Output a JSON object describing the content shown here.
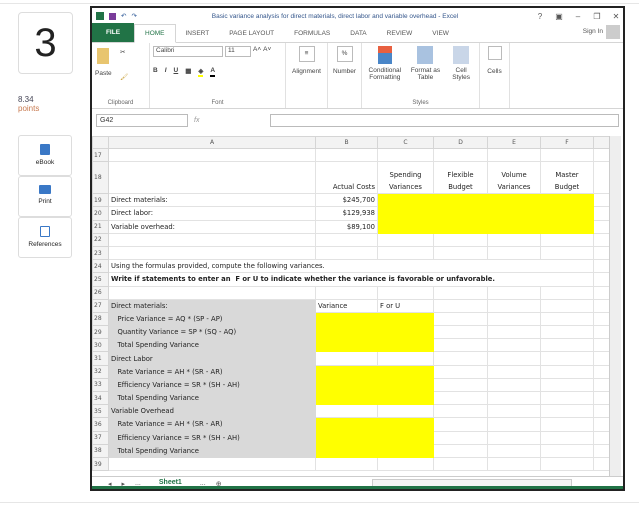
{
  "question": {
    "number": "3",
    "points_value": "8.34",
    "points_label": "points"
  },
  "tools": [
    {
      "label": "eBook"
    },
    {
      "label": "Print"
    },
    {
      "label": "References"
    }
  ],
  "excel": {
    "title": "Basic variance analysis for direct materials, direct labor and variable overhead - Excel",
    "window_buttons": [
      "?",
      "▣",
      "–",
      "❐",
      "✕"
    ],
    "tabs": [
      "FILE",
      "HOME",
      "INSERT",
      "PAGE LAYOUT",
      "FORMULAS",
      "DATA",
      "REVIEW",
      "VIEW"
    ],
    "sign_in": "Sign In",
    "ribbon": {
      "paste": "Paste",
      "clipboard": "Clipboard",
      "font_name": "Calibri",
      "font_size": "11",
      "font": "Font",
      "alignment": "Alignment",
      "number": "Number",
      "conditional_formatting": "Conditional Formatting",
      "format_as_table": "Format as Table",
      "cell_styles": "Cell Styles",
      "styles": "Styles",
      "cells": "Cells"
    },
    "name_box": "G42",
    "fx": "fx",
    "columns": [
      "A",
      "B",
      "C",
      "D",
      "E",
      "F"
    ],
    "rows": [
      {
        "n": "17",
        "a": "",
        "b": ""
      },
      {
        "n": "18",
        "a": "",
        "b": "Actual Costs",
        "c": "Spending Variances",
        "d": "Flexible Budget",
        "e": "Volume Variances",
        "f": "Master Budget"
      },
      {
        "n": "19",
        "a": "Direct materials:",
        "b": "$245,700"
      },
      {
        "n": "20",
        "a": "Direct labor:",
        "b": "$129,938"
      },
      {
        "n": "21",
        "a": "Variable overhead:",
        "b": "$89,100"
      },
      {
        "n": "22",
        "a": ""
      },
      {
        "n": "23",
        "a": ""
      },
      {
        "n": "24",
        "a": "Using the formulas provided, compute the following variances."
      },
      {
        "n": "25",
        "a": "Write if statements to enter an  F or U to indicate whether the variance is favorable or unfavorable."
      },
      {
        "n": "26",
        "a": ""
      },
      {
        "n": "27",
        "a": "Direct materials:",
        "b": "Variance",
        "c": "F or U"
      },
      {
        "n": "28",
        "a": "   Price Variance = AQ * (SP - AP)"
      },
      {
        "n": "29",
        "a": "   Quantity Variance = SP * (SQ - AQ)"
      },
      {
        "n": "30",
        "a": "   Total Spending Variance"
      },
      {
        "n": "31",
        "a": "Direct Labor"
      },
      {
        "n": "32",
        "a": "   Rate Variance = AH * (SR - AR)"
      },
      {
        "n": "33",
        "a": "   Efficiency Variance = SR * (SH - AH)"
      },
      {
        "n": "34",
        "a": "   Total Spending Variance"
      },
      {
        "n": "35",
        "a": "Variable Overhead"
      },
      {
        "n": "36",
        "a": "   Rate Variance = AH * (SR - AR)"
      },
      {
        "n": "37",
        "a": "   Efficiency Variance = SR * (SH - AH)"
      },
      {
        "n": "38",
        "a": "   Total Spending Variance"
      },
      {
        "n": "39",
        "a": ""
      }
    ],
    "sheet_tab": "Sheet1",
    "sheet_ellipsis": "...",
    "add_sheet": "⊕"
  },
  "colors": {
    "excel_green": "#217346",
    "highlight": "#ffff00",
    "gray_fill": "#d9d9d9"
  }
}
